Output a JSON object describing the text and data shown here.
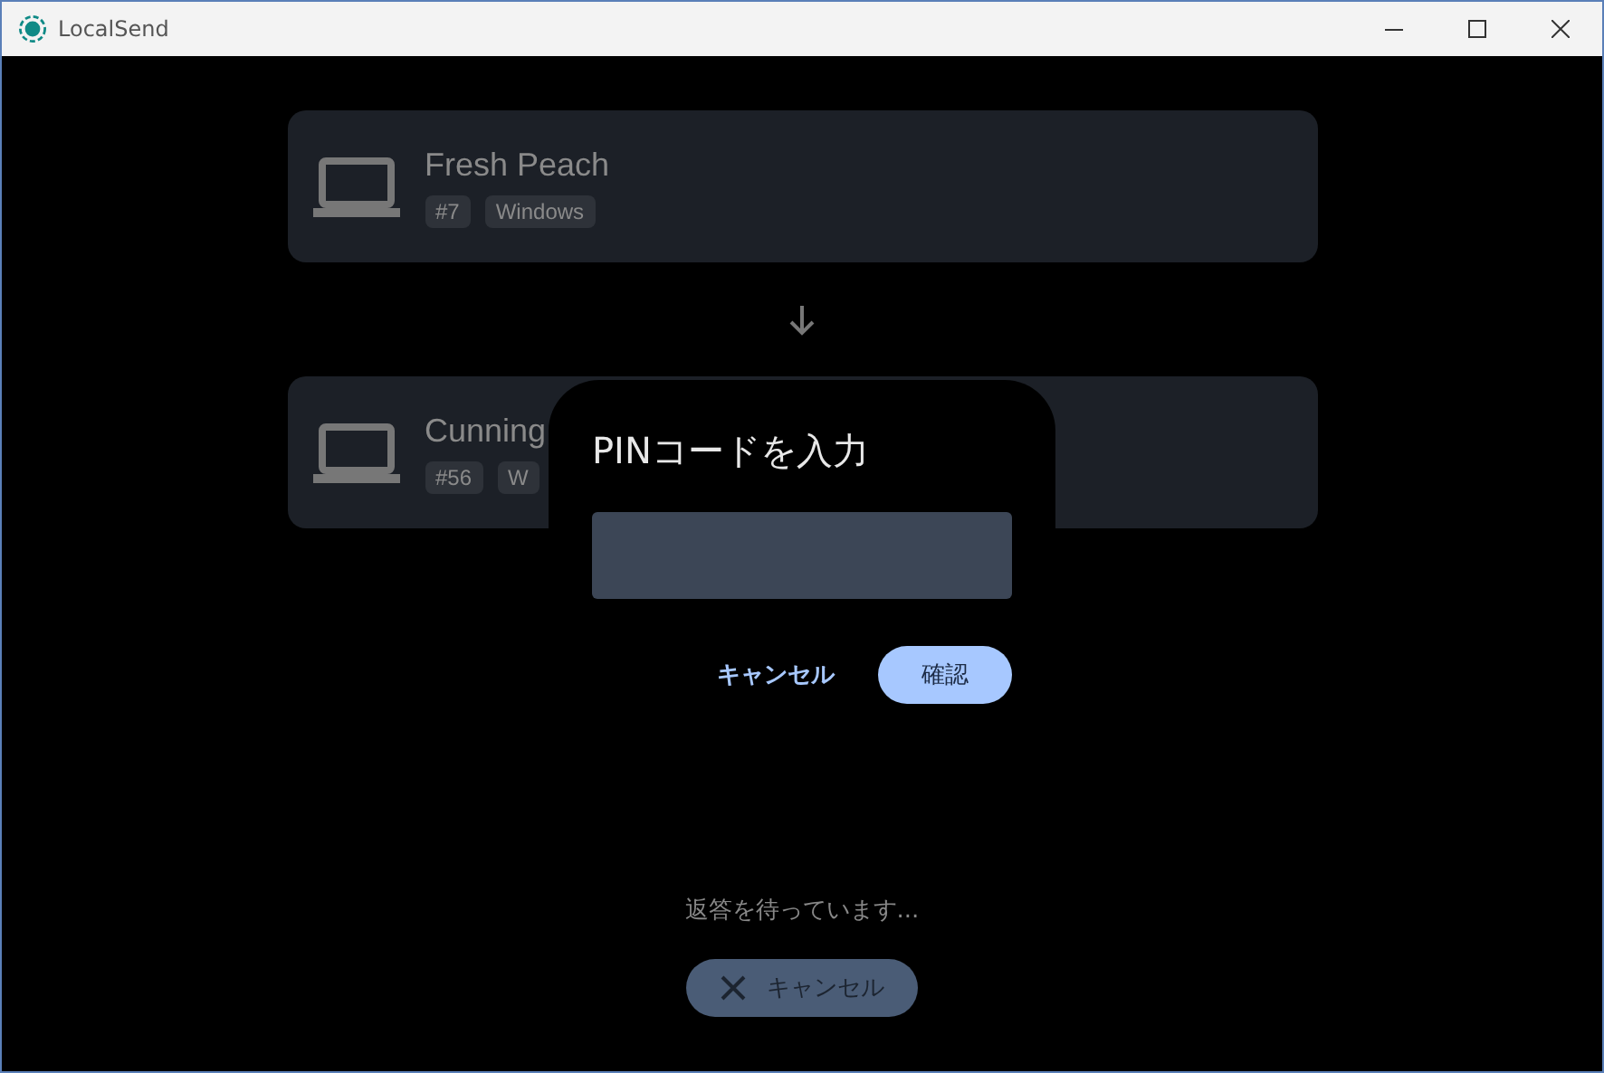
{
  "window": {
    "title": "LocalSend"
  },
  "devices": [
    {
      "name": "Fresh Peach",
      "tags": [
        "#7",
        "Windows"
      ]
    },
    {
      "name": "Cunning",
      "tags": [
        "#56",
        "W"
      ]
    }
  ],
  "dialog": {
    "title": "PINコードを入力",
    "buttons": [
      {
        "label": "キャンセル",
        "kind": "text"
      },
      {
        "label": "確認",
        "kind": "filled"
      }
    ]
  },
  "status": "返答を待っています...",
  "cancel_button": {
    "label": "キャンセル"
  }
}
